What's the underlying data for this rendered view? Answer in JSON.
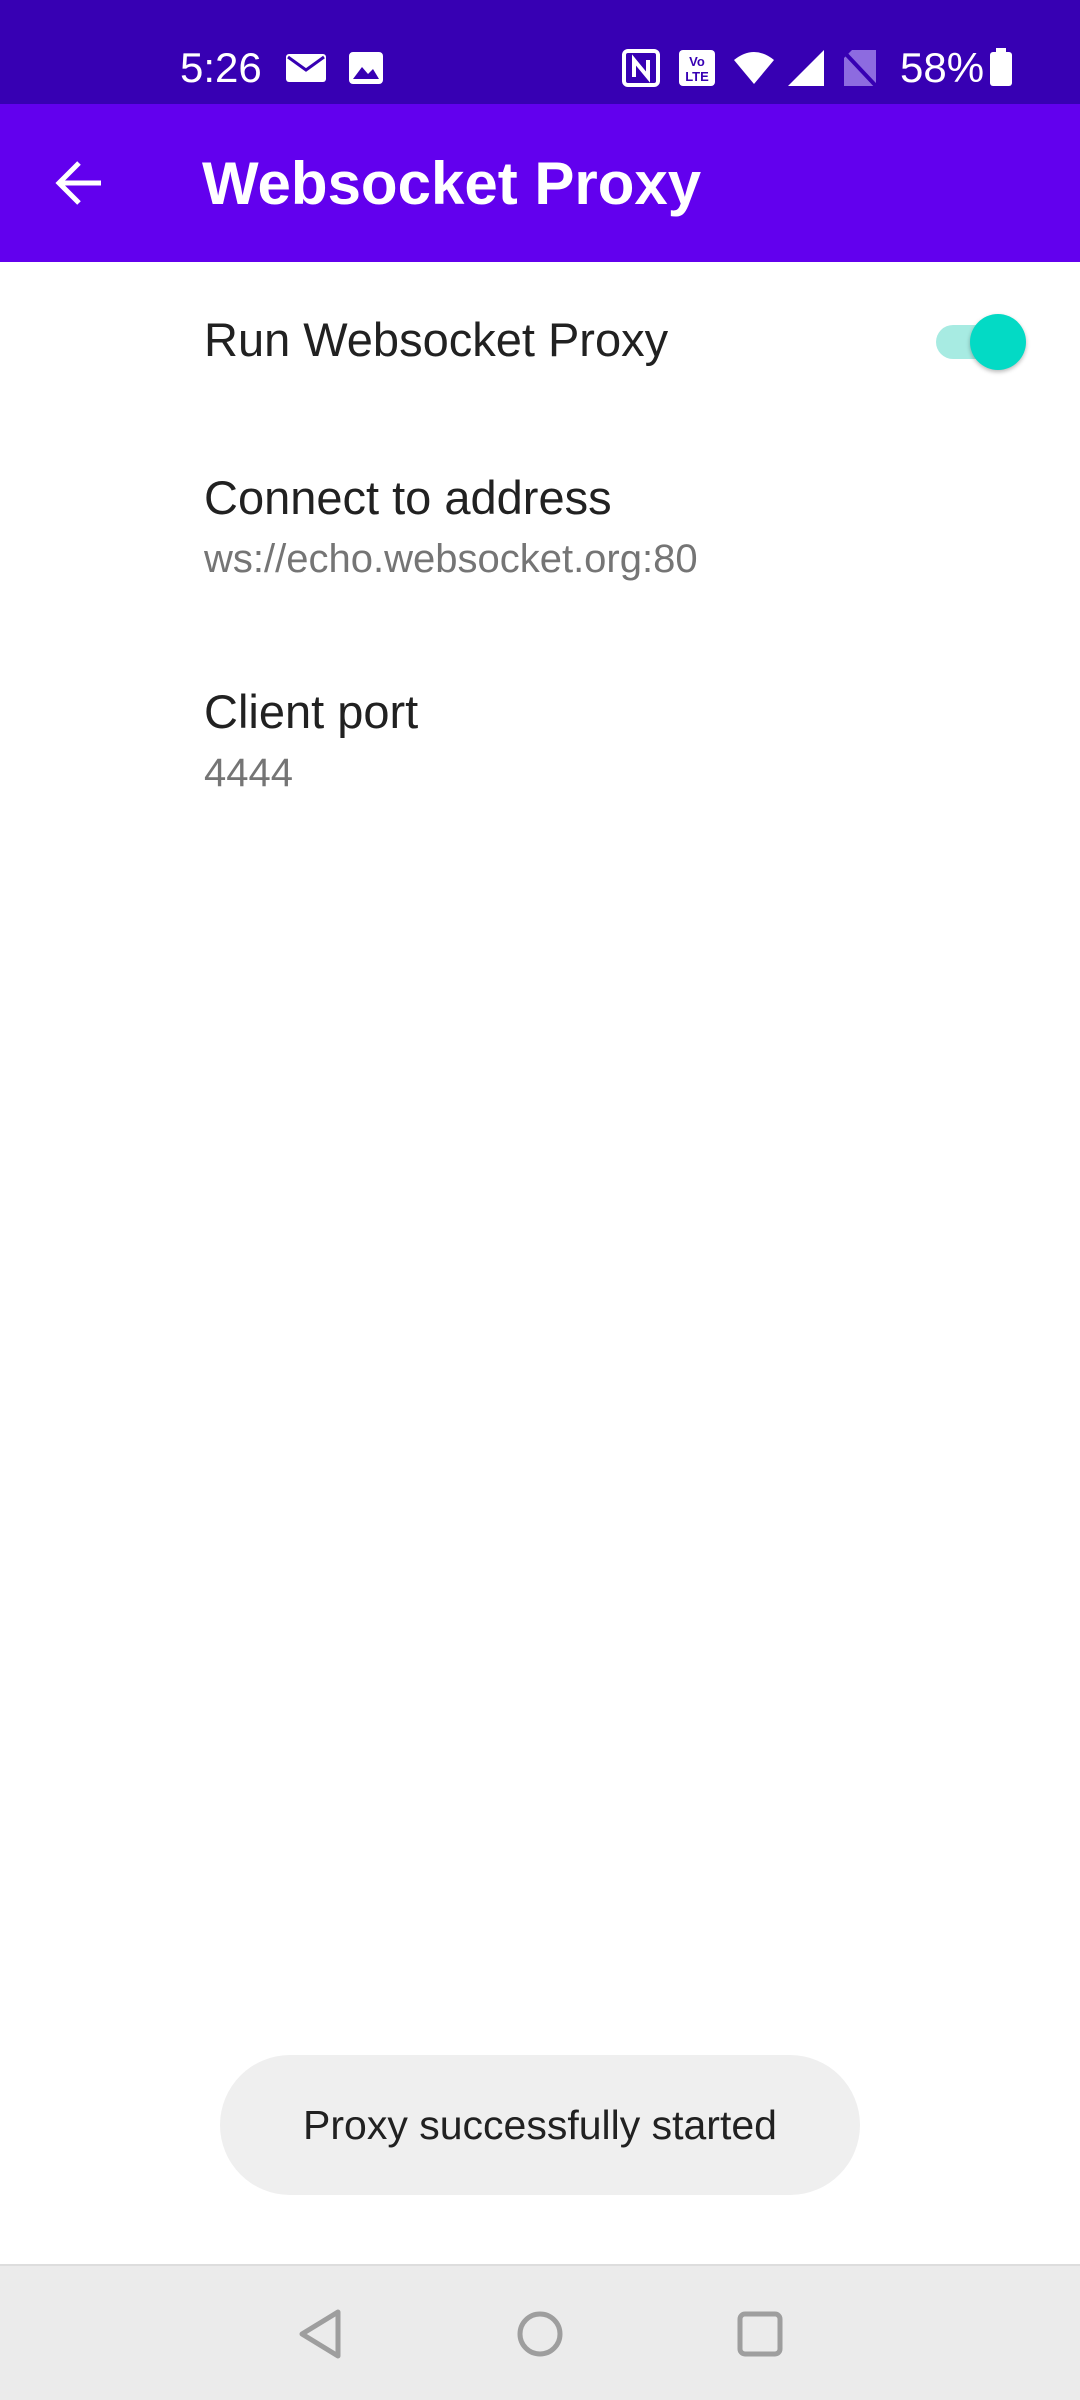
{
  "status_bar": {
    "time": "5:26",
    "battery_percent": "58%",
    "left_icons": [
      "mail-icon",
      "image-icon"
    ],
    "right_icons": [
      "nfc-icon",
      "volte-icon",
      "wifi-icon",
      "signal-icon",
      "no-sim-icon",
      "battery-icon"
    ]
  },
  "app_bar": {
    "title": "Websocket Proxy",
    "back_icon": "arrow-back-icon"
  },
  "preferences": {
    "run_proxy": {
      "title": "Run Websocket Proxy",
      "enabled": true
    },
    "address": {
      "title": "Connect to address",
      "value": "ws://echo.websocket.org:80"
    },
    "port": {
      "title": "Client port",
      "value": "4444"
    }
  },
  "toast": {
    "message": "Proxy successfully started"
  },
  "nav_bar": {
    "buttons": [
      "back-triangle-icon",
      "home-circle-icon",
      "recents-square-icon"
    ]
  },
  "colors": {
    "status_bar": "#3700b3",
    "app_bar": "#6200ee",
    "switch_on": "#03dac5",
    "toast_bg": "#efefef",
    "nav_bar_bg": "#ebebeb"
  }
}
